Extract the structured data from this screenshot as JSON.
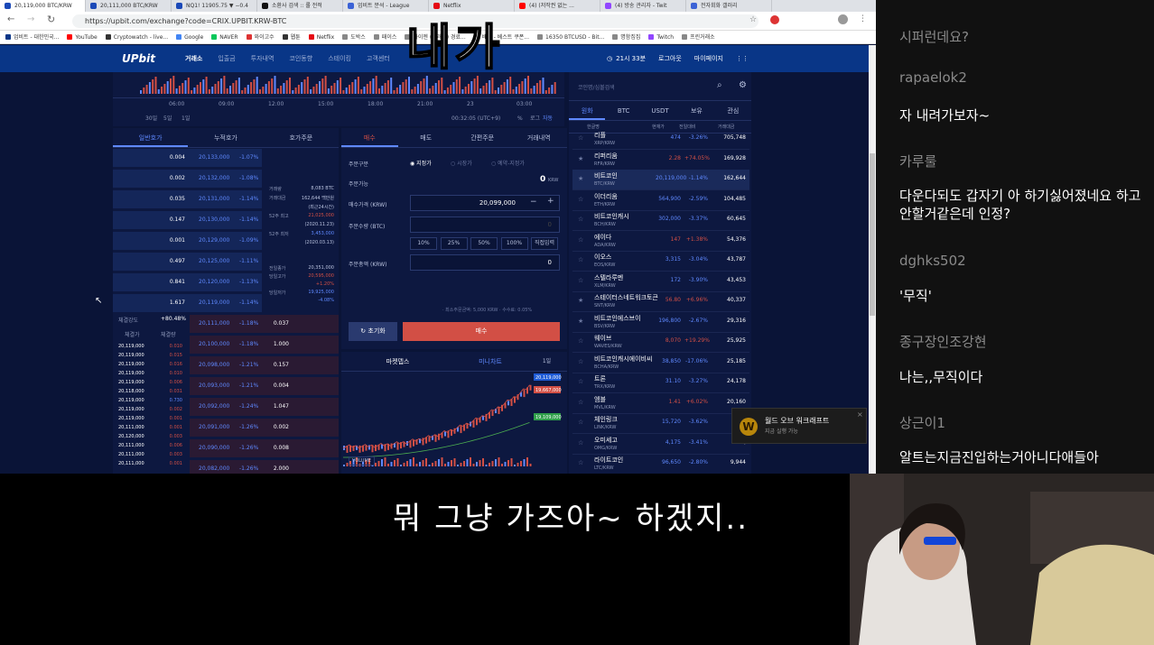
{
  "browser": {
    "tabs": [
      {
        "label": "20,119,000 BTC/KRW",
        "color": "#1b49b8",
        "active": true
      },
      {
        "label": "20,111,000 BTC/KRW",
        "color": "#1b49b8"
      },
      {
        "label": "NQ1! 11905.75 ▼ −0.4",
        "color": "#1b49b8"
      },
      {
        "label": "소환사 검색 :: 롤 전적",
        "color": "#111"
      },
      {
        "label": "업비트 분석 - League",
        "color": "#3b62d6"
      },
      {
        "label": "Netflix",
        "color": "#e50914"
      },
      {
        "label": "(4) (저작권 없는 ...",
        "color": "#ff0000"
      },
      {
        "label": "(4) 방송 관리자 - Twit",
        "color": "#9146ff"
      },
      {
        "label": "전자회화 갤러리",
        "color": "#3b62d6"
      }
    ],
    "url": "https://upbit.com/exchange?code=CRIX.UPBIT.KRW-BTC",
    "bookmarks": [
      {
        "label": "업비트 - 대한민국...",
        "color": "#093687"
      },
      {
        "label": "YouTube",
        "color": "#ff0000"
      },
      {
        "label": "Cryptowatch - live...",
        "color": "#333"
      },
      {
        "label": "Google",
        "color": "#4285f4"
      },
      {
        "label": "NAVER",
        "color": "#03c75a"
      },
      {
        "label": "와이고수",
        "color": "#d33"
      },
      {
        "label": "웹툰",
        "color": "#333"
      },
      {
        "label": "Netflix",
        "color": "#e50914"
      },
      {
        "label": "도박스",
        "color": "#888"
      },
      {
        "label": "패이스",
        "color": "#888"
      },
      {
        "label": "라이젠 (크래시) 경료...",
        "color": "#888"
      },
      {
        "label": "배게 - 베스트 쿠폰...",
        "color": "#888"
      },
      {
        "label": "16350 BTCUSD - Bit...",
        "color": "#888"
      },
      {
        "label": "명함집집",
        "color": "#888"
      },
      {
        "label": "Twitch",
        "color": "#9146ff"
      },
      {
        "label": "프린거래소",
        "color": "#888"
      }
    ]
  },
  "upbit": {
    "logo": "UPbit",
    "nav": [
      "거래소",
      "입출금",
      "투자내역",
      "코인동향",
      "스테이킹",
      "고객센터"
    ],
    "clock": "21시 33분",
    "login": "로그아웃",
    "mypage": "마이페이지",
    "chart_times": [
      "06:00",
      "09:00",
      "12:00",
      "15:00",
      "18:00",
      "21:00",
      "23",
      "03:00"
    ],
    "chart_timestamp": "00:32:05 (UTC+9)",
    "chart_ranges": [
      "30일",
      "5일",
      "1일"
    ],
    "chart_opts": [
      "%",
      "로그",
      "자동"
    ],
    "orderbook_tabs": [
      "일반호가",
      "누적호가",
      "호가주문"
    ],
    "orderbook": [
      {
        "qty": "0.004",
        "price": "20,133,000",
        "pct": "-1.07%",
        "type": "ask"
      },
      {
        "qty": "0.002",
        "price": "20,132,000",
        "pct": "-1.08%",
        "type": "ask"
      },
      {
        "qty": "0.035",
        "price": "20,131,000",
        "pct": "-1.14%",
        "type": "ask"
      },
      {
        "qty": "0.147",
        "price": "20,130,000",
        "pct": "-1.14%",
        "type": "ask"
      },
      {
        "qty": "0.001",
        "price": "20,129,000",
        "pct": "-1.09%",
        "type": "ask"
      },
      {
        "qty": "0.497",
        "price": "20,125,000",
        "pct": "-1.11%",
        "type": "ask"
      },
      {
        "qty": "0.841",
        "price": "20,120,000",
        "pct": "-1.13%",
        "type": "ask"
      },
      {
        "qty": "1.617",
        "price": "20,119,000",
        "pct": "-1.14%",
        "type": "ask"
      },
      {
        "qty": "0.037",
        "price": "20,111,000",
        "pct": "-1.18%",
        "type": "bid"
      },
      {
        "qty": "1.000",
        "price": "20,100,000",
        "pct": "-1.18%",
        "type": "bid"
      },
      {
        "qty": "0.157",
        "price": "20,098,000",
        "pct": "-1.21%",
        "type": "bid"
      },
      {
        "qty": "0.004",
        "price": "20,093,000",
        "pct": "-1.21%",
        "type": "bid"
      },
      {
        "qty": "1.047",
        "price": "20,092,000",
        "pct": "-1.24%",
        "type": "bid"
      },
      {
        "qty": "0.002",
        "price": "20,091,000",
        "pct": "-1.26%",
        "type": "bid"
      },
      {
        "qty": "0.008",
        "price": "20,090,000",
        "pct": "-1.26%",
        "type": "bid"
      },
      {
        "qty": "2.000",
        "price": "20,082,000",
        "pct": "-1.26%",
        "type": "bid"
      }
    ],
    "stats": [
      {
        "label": "거래량",
        "value": "8,083 BTC"
      },
      {
        "label": "거래대금",
        "value": "162,644 백만원"
      },
      {
        "label": "",
        "value": "(최근24시간)"
      },
      {
        "label": "52주 최고",
        "value": "21,025,000"
      },
      {
        "label": "",
        "value": "(2020.11.23)"
      },
      {
        "label": "52주 최저",
        "value": "3,453,000"
      },
      {
        "label": "",
        "value": "(2020.03.13)"
      }
    ],
    "stats2": [
      {
        "label": "전일종가",
        "value": "20,351,000"
      },
      {
        "label": "당일고가",
        "value": "20,595,000"
      },
      {
        "label": "",
        "value": "+1.20%"
      },
      {
        "label": "당일저가",
        "value": "19,925,000"
      },
      {
        "label": "",
        "value": "-4.08%"
      }
    ],
    "strength_label": "체결강도",
    "strength": "+80.48%",
    "trade_headers": [
      "체결가",
      "체결량"
    ],
    "trades": [
      "20,119,000",
      "20,119,000",
      "20,119,000",
      "20,119,000",
      "20,119,000",
      "20,118,000",
      "20,119,000",
      "20,119,000",
      "20,119,000",
      "20,111,000",
      "20,120,000",
      "20,111,000",
      "20,111,000",
      "20,111,000"
    ],
    "trade_qty": [
      "0.010",
      "0.015",
      "0.016",
      "0.010",
      "0.006",
      "0.031",
      "0.730",
      "0.002",
      "0.001",
      "0.001",
      "0.003",
      "0.006",
      "0.003",
      "0.001"
    ],
    "order_tabs": [
      "매수",
      "매도",
      "간편주문",
      "거래내역"
    ],
    "order": {
      "type_label": "주문구분",
      "types": [
        "지정가",
        "시장가",
        "예약-지정가"
      ],
      "avail_label": "주문가능",
      "avail_value": "0",
      "avail_unit": "KRW",
      "price_label": "매수가격 (KRW)",
      "price_value": "20,099,000",
      "qty_label": "주문수량 (BTC)",
      "qty_value": "0",
      "pcts": [
        "10%",
        "25%",
        "50%",
        "100%",
        "직접입력"
      ],
      "total_label": "주문총액 (KRW)",
      "total_value": "0",
      "fee_note": "· 최소주문금액: 5,000 KRW  · 수수료: 0.05%",
      "reset": "초기화",
      "buy": "매수"
    },
    "market_tabs": [
      "마켓뎁스",
      "미니차트"
    ],
    "market_range": "1일",
    "mini_prices": [
      "20,119,000",
      "19,667,000",
      "19,109,000"
    ],
    "volume_label": "VOLUME",
    "coin_search_placeholder": "코인명/심볼검색",
    "coin_tabs": [
      "원화",
      "BTC",
      "USDT",
      "보유",
      "관심"
    ],
    "coin_headers": [
      "한글명",
      "현재가",
      "전일대비",
      "거래대금"
    ],
    "coins": [
      {
        "name": "리플",
        "sym": "XRP/KRW",
        "price": "474",
        "change": "-3.26%",
        "vol": "705,748",
        "color": "#5f89ff"
      },
      {
        "name": "리퍼리움",
        "sym": "RFR/KRW",
        "price": "2.28",
        "change": "+74.05%",
        "vol": "169,928",
        "color": "#d24f45"
      },
      {
        "name": "비트코인",
        "sym": "BTC/KRW",
        "price": "20,119,000",
        "change": "-1.14%",
        "vol": "162,644",
        "color": "#5f89ff"
      },
      {
        "name": "이더리움",
        "sym": "ETH/KRW",
        "price": "564,900",
        "change": "-2.59%",
        "vol": "104,485",
        "color": "#5f89ff"
      },
      {
        "name": "비트코인캐시",
        "sym": "BCH/KRW",
        "price": "302,000",
        "change": "-3.37%",
        "vol": "60,645",
        "color": "#5f89ff"
      },
      {
        "name": "에이다",
        "sym": "ADA/KRW",
        "price": "147",
        "change": "+1.38%",
        "vol": "54,376",
        "color": "#d24f45"
      },
      {
        "name": "이오스",
        "sym": "EOS/KRW",
        "price": "3,315",
        "change": "-3.04%",
        "vol": "43,787",
        "color": "#5f89ff"
      },
      {
        "name": "스텔라루멘",
        "sym": "XLM/KRW",
        "price": "172",
        "change": "-3.90%",
        "vol": "43,453",
        "color": "#5f89ff"
      },
      {
        "name": "스테이터스네트워크토큰",
        "sym": "SNT/KRW",
        "price": "56.80",
        "change": "+6.96%",
        "vol": "40,337",
        "color": "#d24f45"
      },
      {
        "name": "비트코인에스브이",
        "sym": "BSV/KRW",
        "price": "196,800",
        "change": "-2.67%",
        "vol": "29,316",
        "color": "#5f89ff"
      },
      {
        "name": "웨이브",
        "sym": "WAVES/KRW",
        "price": "8,070",
        "change": "+19.29%",
        "vol": "25,925",
        "color": "#d24f45"
      },
      {
        "name": "비트코인캐시에이비씨",
        "sym": "BCHA/KRW",
        "price": "38,850",
        "change": "-17.06%",
        "vol": "25,185",
        "color": "#5f89ff"
      },
      {
        "name": "트론",
        "sym": "TRX/KRW",
        "price": "31.10",
        "change": "-3.27%",
        "vol": "24,178",
        "color": "#5f89ff"
      },
      {
        "name": "엠블",
        "sym": "MVL/KRW",
        "price": "1.41",
        "change": "+6.02%",
        "vol": "20,160",
        "color": "#d24f45"
      },
      {
        "name": "체인링크",
        "sym": "LINK/KRW",
        "price": "15,720",
        "change": "-3.62%",
        "vol": "17,2",
        "color": "#5f89ff"
      },
      {
        "name": "오미세고",
        "sym": "OMG/KRW",
        "price": "4,175",
        "change": "-3.41%",
        "vol": "10,",
        "color": "#5f89ff"
      },
      {
        "name": "라이트코인",
        "sym": "LTC/KRW",
        "price": "96,650",
        "change": "-2.80%",
        "vol": "9,944",
        "color": "#5f89ff"
      }
    ]
  },
  "overlay_text": "내가",
  "chat": [
    {
      "kind": "user",
      "text": "시퍼런데요?"
    },
    {
      "kind": "user",
      "text": "rapaelok2"
    },
    {
      "kind": "msg",
      "text": "자 내려가보자~"
    },
    {
      "kind": "user",
      "text": "카루룰"
    },
    {
      "kind": "msg",
      "text": "다운다되도 갑자기 아 하기싫어졌네요 하고 안할거같은데 인정?"
    },
    {
      "kind": "user",
      "text": "dghks502"
    },
    {
      "kind": "msg",
      "text": "'무직'"
    },
    {
      "kind": "user",
      "text": "종구장인조강현"
    },
    {
      "kind": "msg",
      "text": "나는,,무직이다"
    },
    {
      "kind": "user",
      "text": "상근이1"
    },
    {
      "kind": "msg",
      "text": "알트는지금진입하는거아니다애들아"
    }
  ],
  "notification": {
    "title": "월드 오브 워크래프트",
    "sub": "지금 실행 가능"
  },
  "subtitle": "뭐 그냥 가즈아~ 하겠지.."
}
